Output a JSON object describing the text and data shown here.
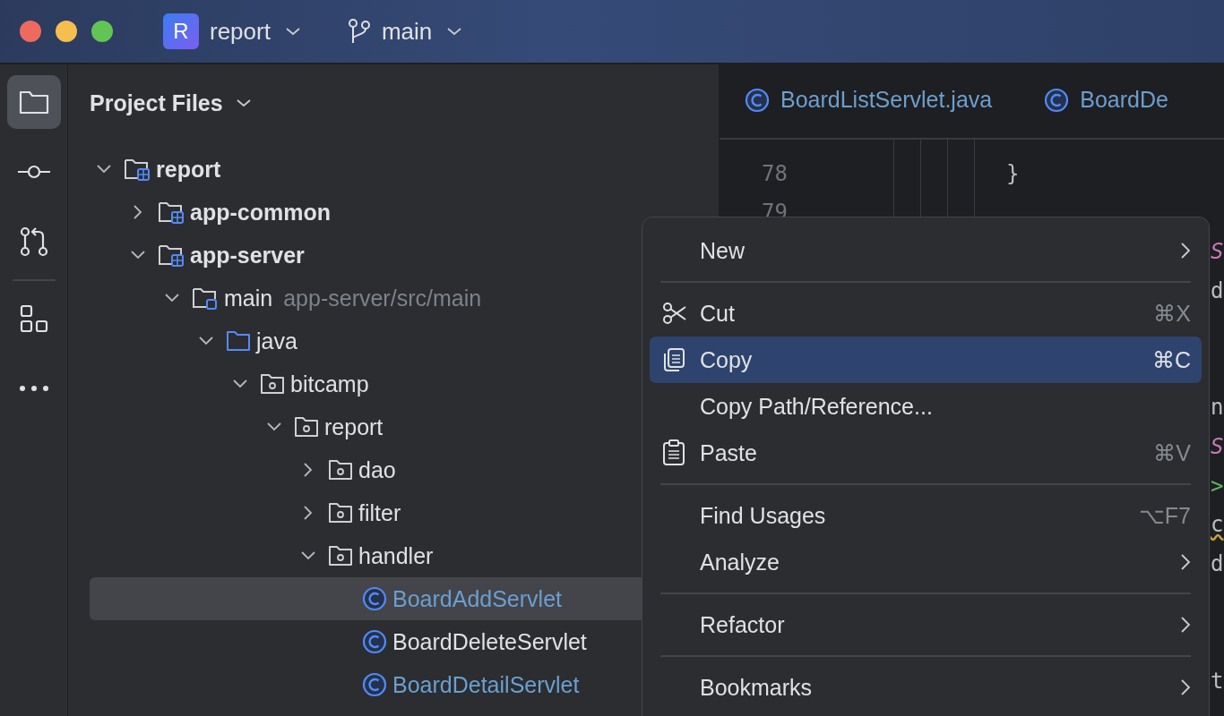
{
  "title_bar": {
    "project_badge": "R",
    "project": "report",
    "branch": "main"
  },
  "tool_buttons": [
    {
      "kind": "folder",
      "selected": true
    },
    {
      "kind": "commit",
      "selected": false
    },
    {
      "kind": "pull-requests",
      "selected": false
    },
    {
      "kind": "structure",
      "selected": false
    },
    {
      "kind": "more",
      "selected": false
    }
  ],
  "project_panel": {
    "title": "Project Files",
    "tree": [
      {
        "kind": "module",
        "label": "report",
        "expanded": true,
        "selected": false,
        "children": [
          {
            "kind": "module",
            "label": "app-common",
            "expanded": false,
            "selected": false
          },
          {
            "kind": "module",
            "label": "app-server",
            "expanded": true,
            "selected": false,
            "children": [
              {
                "kind": "source-set",
                "label": "main",
                "hint": "app-server/src/main",
                "expanded": true,
                "selected": false,
                "children": [
                  {
                    "kind": "source-root",
                    "label": "java",
                    "expanded": true,
                    "selected": false,
                    "children": [
                      {
                        "kind": "package",
                        "label": "bitcamp",
                        "expanded": true,
                        "selected": false,
                        "children": [
                          {
                            "kind": "package",
                            "label": "report",
                            "expanded": true,
                            "selected": false,
                            "children": [
                              {
                                "kind": "package",
                                "label": "dao",
                                "expanded": false,
                                "selected": false
                              },
                              {
                                "kind": "package",
                                "label": "filter",
                                "expanded": false,
                                "selected": false
                              },
                              {
                                "kind": "package",
                                "label": "handler",
                                "expanded": true,
                                "selected": false,
                                "children": [
                                  {
                                    "kind": "class",
                                    "label": "BoardAddServlet",
                                    "modified": true,
                                    "selected": true
                                  },
                                  {
                                    "kind": "class",
                                    "label": "BoardDeleteServlet",
                                    "modified": false,
                                    "selected": false
                                  },
                                  {
                                    "kind": "class",
                                    "label": "BoardDetailServlet",
                                    "modified": true,
                                    "selected": false
                                  }
                                ]
                              }
                            ]
                          }
                        ]
                      }
                    ]
                  }
                ]
              }
            ]
          }
        ]
      }
    ]
  },
  "editor": {
    "tabs": [
      {
        "label": "BoardListServlet.java",
        "selected": false
      },
      {
        "label": "BoardDe",
        "selected": false
      }
    ],
    "blocks": [
      [
        {
          "number": "78",
          "segments": [
            {
              "kind": "plain",
              "text": "}"
            }
          ]
        },
        {
          "number": "79"
        },
        {
          "segments": [
            {
              "kind": "annotation",
              "text": "S"
            }
          ]
        },
        {
          "segments": [
            {
              "kind": "plain",
              "text": "d"
            }
          ]
        }
      ],
      [
        {
          "segments": [
            {
              "kind": "plain",
              "text": "n"
            }
          ]
        },
        {
          "segments": [
            {
              "kind": "annotation",
              "text": "S"
            }
          ]
        },
        {
          "segments": [
            {
              "kind": "operator",
              "text": ">"
            }
          ]
        },
        {
          "segments": [
            {
              "kind": "warning",
              "text": "c"
            }
          ]
        },
        {
          "segments": [
            {
              "kind": "plain",
              "text": "d"
            }
          ]
        }
      ],
      [
        {
          "segments": [
            {
              "kind": "plain",
              "text": "t"
            }
          ]
        }
      ]
    ]
  },
  "context_menu": {
    "items": [
      {
        "kind": "item",
        "label": "New",
        "submenu": true,
        "selected": false
      },
      {
        "kind": "separator"
      },
      {
        "kind": "cut",
        "label": "Cut",
        "shortcut": "⌘X",
        "submenu": false,
        "selected": false
      },
      {
        "kind": "copy",
        "label": "Copy",
        "shortcut": "⌘C",
        "submenu": false,
        "selected": true
      },
      {
        "kind": "item",
        "label": "Copy Path/Reference...",
        "submenu": false,
        "selected": false
      },
      {
        "kind": "paste",
        "label": "Paste",
        "shortcut": "⌘V",
        "submenu": false,
        "selected": false
      },
      {
        "kind": "separator"
      },
      {
        "kind": "item",
        "label": "Find Usages",
        "shortcut": "⌥F7",
        "submenu": false,
        "selected": false
      },
      {
        "kind": "item",
        "label": "Analyze",
        "submenu": true,
        "selected": false
      },
      {
        "kind": "separator"
      },
      {
        "kind": "item",
        "label": "Refactor",
        "submenu": true,
        "selected": false
      },
      {
        "kind": "separator"
      },
      {
        "kind": "item",
        "label": "Bookmarks",
        "submenu": true,
        "selected": false
      }
    ]
  }
}
